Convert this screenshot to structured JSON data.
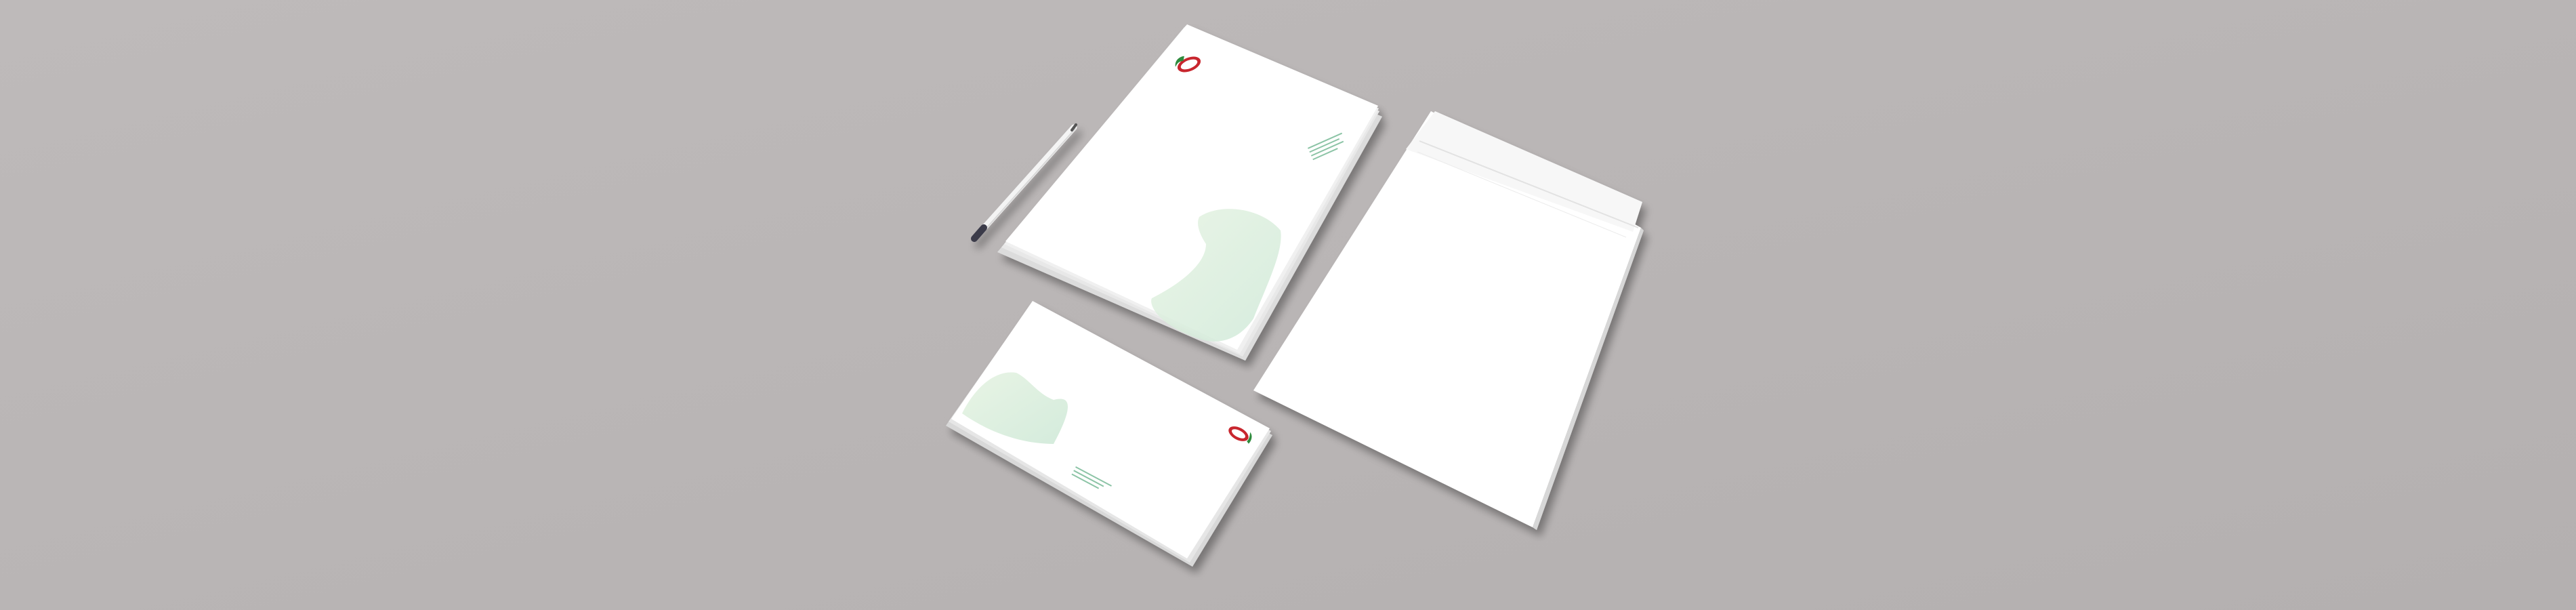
{
  "scene": {
    "description_items": [
      "letterhead-stack",
      "pen",
      "compliment-card-stack",
      "large-envelope"
    ],
    "colors": {
      "background": "#bab6b6",
      "paper": "#ffffff",
      "leaf_green": "#d9efdf",
      "logo_red": "#c8262e",
      "logo_green": "#2e8b3c"
    }
  },
  "letterhead": {
    "logo_icon": "brand-logo-icon",
    "address_lines": [
      "",
      "",
      "",
      ""
    ]
  },
  "card": {
    "logo_icon": "brand-logo-icon",
    "address_lines": [
      "",
      "",
      ""
    ]
  },
  "envelope": {
    "flap_icon": "envelope-flap"
  }
}
